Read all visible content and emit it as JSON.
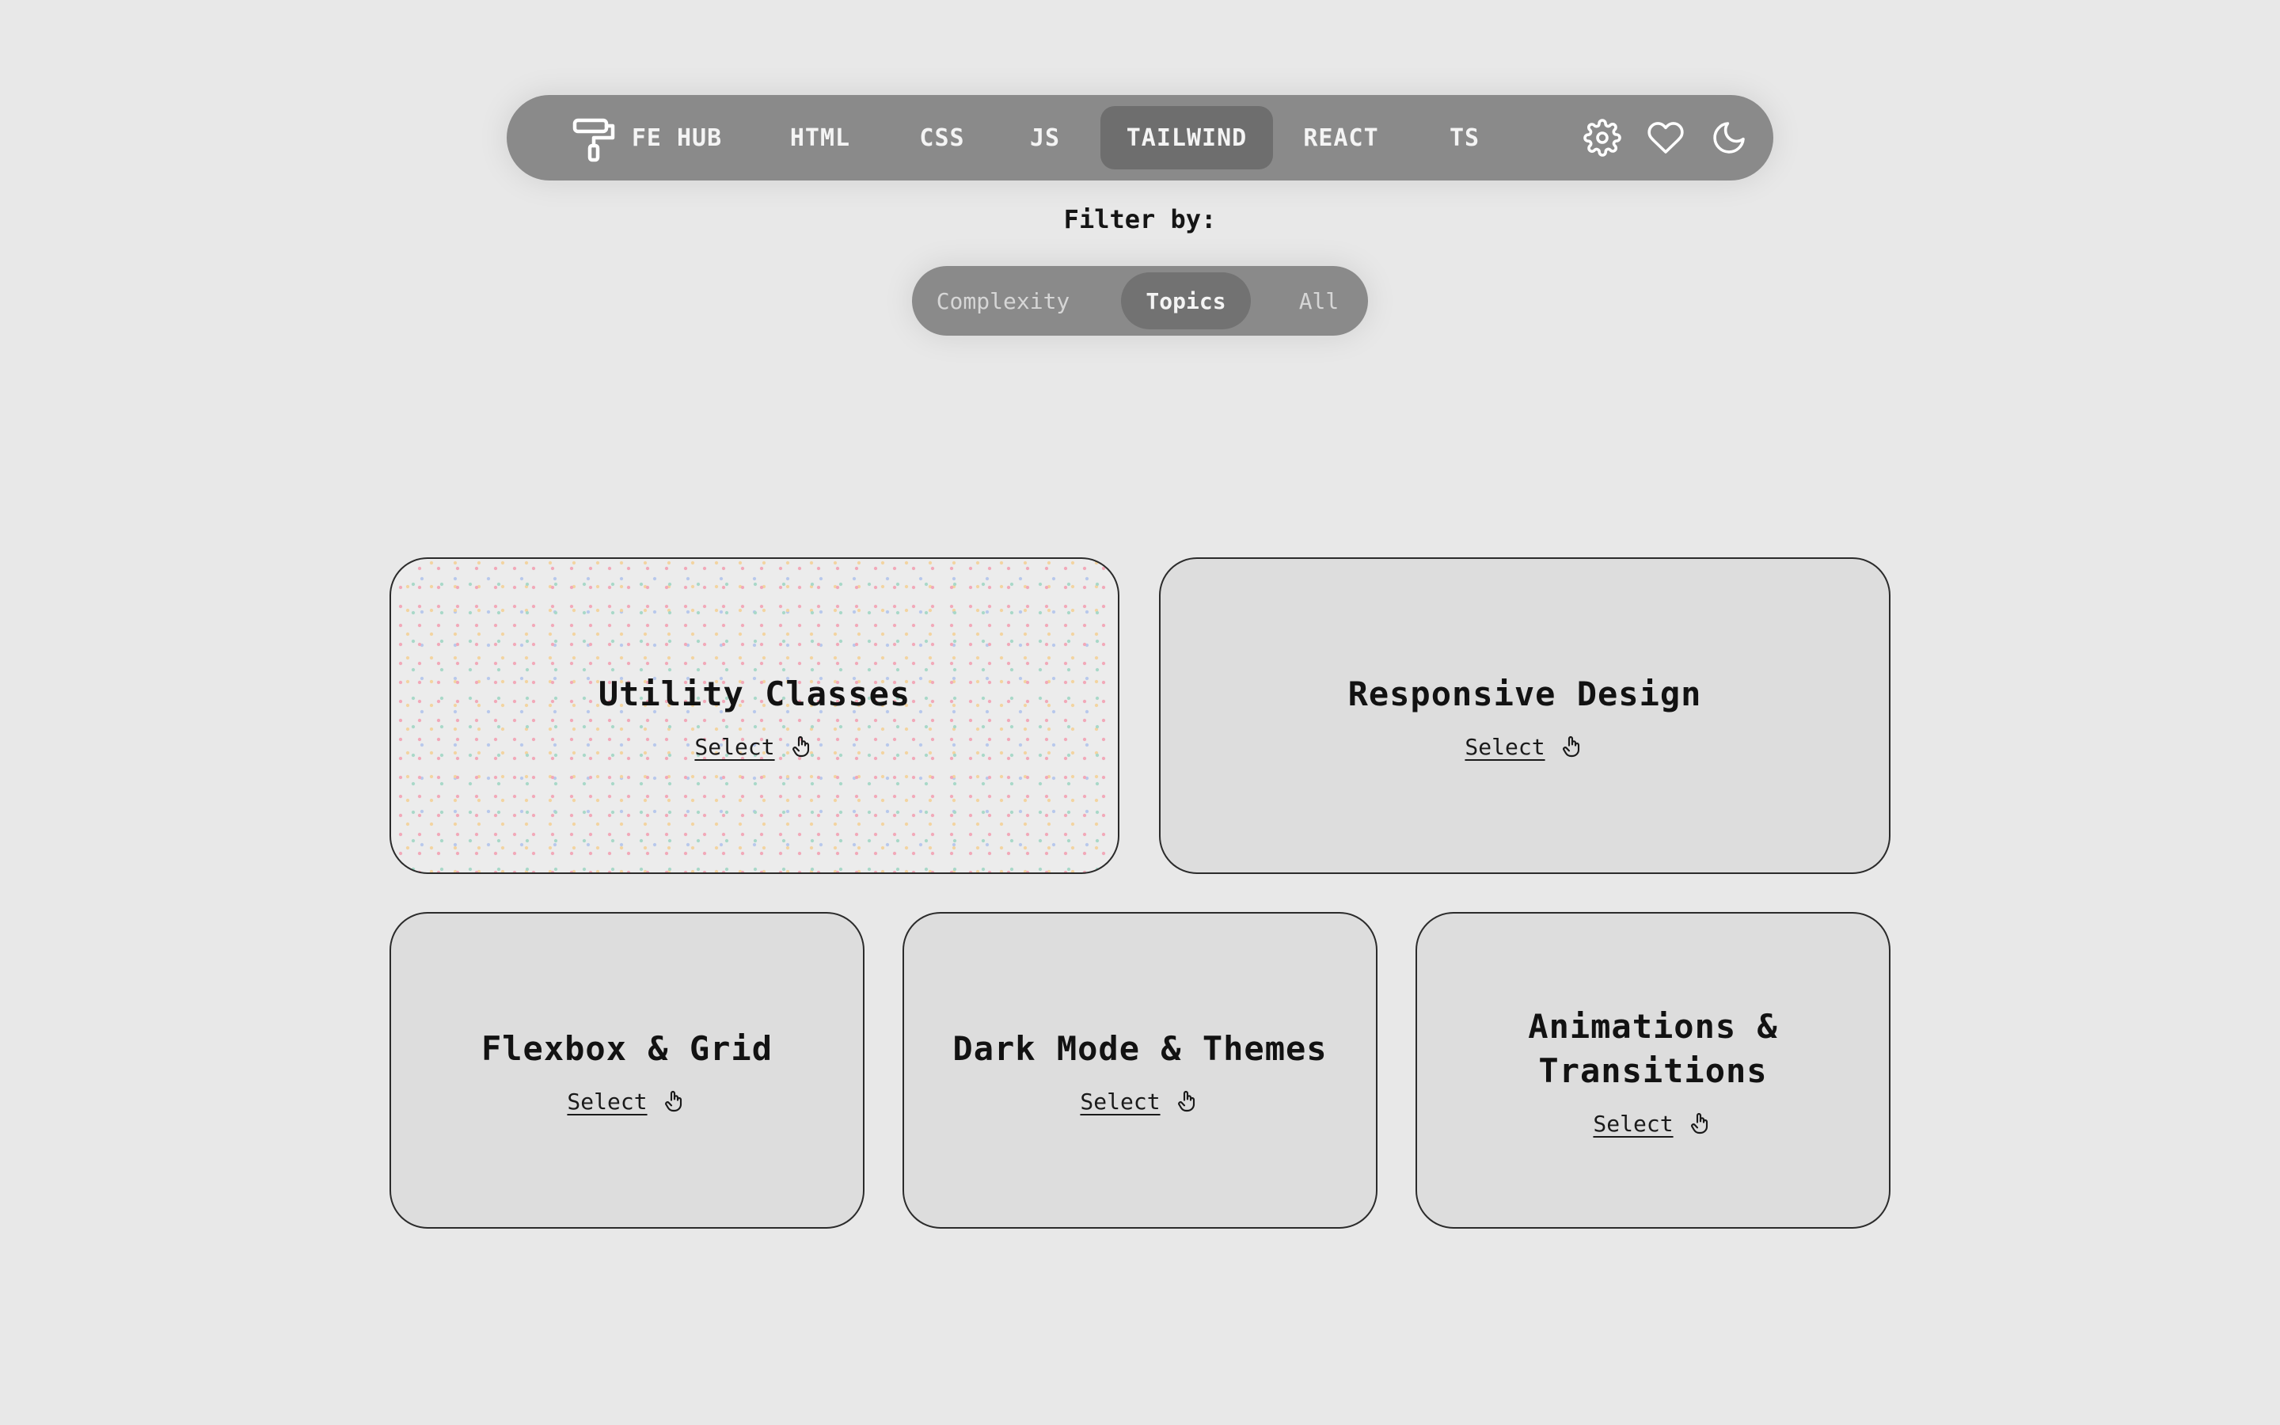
{
  "nav": {
    "brand": "FE HUB",
    "items": [
      {
        "label": "HTML",
        "active": false
      },
      {
        "label": "CSS",
        "active": false
      },
      {
        "label": "JS",
        "active": false
      },
      {
        "label": "TAILWIND",
        "active": true
      },
      {
        "label": "REACT",
        "active": false
      },
      {
        "label": "TS",
        "active": false
      }
    ],
    "icons": [
      "settings-icon",
      "heart-icon",
      "moon-icon"
    ]
  },
  "filter": {
    "label": "Filter by:",
    "options": [
      {
        "label": "Complexity",
        "active": false
      },
      {
        "label": "Topics",
        "active": true
      },
      {
        "label": "All",
        "active": false
      }
    ]
  },
  "cards": [
    {
      "title": "Utility Classes",
      "select": "Select",
      "highlighted": true
    },
    {
      "title": "Responsive Design",
      "select": "Select",
      "highlighted": false
    },
    {
      "title": "Flexbox & Grid",
      "select": "Select",
      "highlighted": false
    },
    {
      "title": "Dark Mode & Themes",
      "select": "Select",
      "highlighted": false
    },
    {
      "title": "Animations & Transitions",
      "select": "Select",
      "highlighted": false
    }
  ],
  "colors": {
    "page_bg": "#e8e8e8",
    "nav_bg": "#8a8a8a",
    "nav_active_bg": "#6e6e6e",
    "card_bg": "#dddddd",
    "card_border": "#2b2b2b"
  }
}
